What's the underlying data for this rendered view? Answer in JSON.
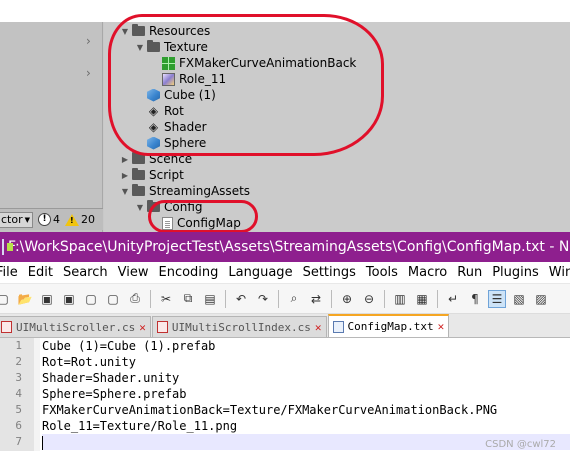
{
  "unity": {
    "tree": [
      {
        "label": "Resources",
        "type": "folder",
        "expanded": true,
        "indent": 0
      },
      {
        "label": "Texture",
        "type": "folder",
        "expanded": true,
        "indent": 1
      },
      {
        "label": "FXMakerCurveAnimationBack",
        "type": "texture-green",
        "indent": 2
      },
      {
        "label": "Role_11",
        "type": "texture-image",
        "indent": 2
      },
      {
        "label": "Cube (1)",
        "type": "prefab",
        "indent": 1
      },
      {
        "label": "Rot",
        "type": "scene",
        "indent": 1
      },
      {
        "label": "Shader",
        "type": "scene",
        "indent": 1
      },
      {
        "label": "Sphere",
        "type": "prefab",
        "indent": 1
      },
      {
        "label": "Scence",
        "type": "folder",
        "expanded": false,
        "indent": 0
      },
      {
        "label": "Script",
        "type": "folder",
        "expanded": false,
        "indent": 0
      },
      {
        "label": "StreamingAssets",
        "type": "folder",
        "expanded": true,
        "indent": 0
      },
      {
        "label": "Config",
        "type": "folder",
        "expanded": true,
        "indent": 1
      },
      {
        "label": "ConfigMap",
        "type": "text-file",
        "indent": 2
      }
    ],
    "status": {
      "dropdown_text": "ctor",
      "info_count": "4",
      "warn_count": "20"
    }
  },
  "notepad": {
    "title": "F:\\WorkSpace\\UnityProjectTest\\Assets\\StreamingAssets\\Config\\ConfigMap.txt - Notepad++",
    "menu": [
      "File",
      "Edit",
      "Search",
      "View",
      "Encoding",
      "Language",
      "Settings",
      "Tools",
      "Macro",
      "Run",
      "Plugins",
      "Win"
    ],
    "tabs": [
      {
        "label": "UIMultiScroller.cs",
        "active": false
      },
      {
        "label": "UIMultiScrollIndex.cs",
        "active": false
      },
      {
        "label": "ConfigMap.txt",
        "active": true
      }
    ],
    "lines": [
      "Cube (1)=Cube (1).prefab",
      "Rot=Rot.unity",
      "Shader=Shader.unity",
      "Sphere=Sphere.prefab",
      "FXMakerCurveAnimationBack=Texture/FXMakerCurveAnimationBack.PNG",
      "Role_11=Texture/Role_11.png",
      ""
    ],
    "line_numbers": [
      "1",
      "2",
      "3",
      "4",
      "5",
      "6",
      "7"
    ]
  },
  "watermark": "CSDN @cwl72",
  "colors": {
    "titlebar": "#8e1f8e",
    "annotation": "#e0102a",
    "current_line": "#e8e8ff"
  }
}
